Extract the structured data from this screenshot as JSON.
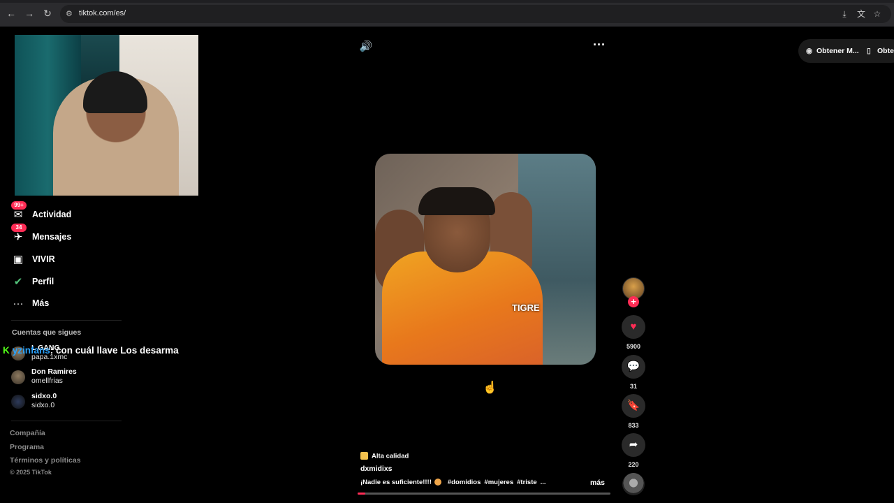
{
  "browser": {
    "url": "tiktok.com/es/",
    "back_icon": "←",
    "forward_icon": "→",
    "reload_icon": "↻",
    "site_icon": "⚙",
    "install_icon": "⤓",
    "translate_icon": "文",
    "bookmark_icon": "☆"
  },
  "sidebar": {
    "items": [
      {
        "label": "Actividad",
        "badge": "99+",
        "icon": "✉"
      },
      {
        "label": "Mensajes",
        "badge": "34",
        "icon": "✈"
      },
      {
        "label": "VIVIR",
        "badge": "",
        "icon": "▣"
      },
      {
        "label": "Perfil",
        "badge": "",
        "icon": "✔"
      },
      {
        "label": "Más",
        "badge": "",
        "icon": "···"
      }
    ],
    "following_title": "Cuentas que sigues",
    "following": [
      {
        "name": "L GANG",
        "user": "papa.1xmc"
      },
      {
        "name": "Don Ramires",
        "user": "omellfrias"
      },
      {
        "name": "sidxo.0",
        "user": "sidxo.0"
      }
    ],
    "footer": [
      "Compañía",
      "Programa",
      "Términos y políticas"
    ],
    "copyright": "© 2025 TikTok"
  },
  "chat": {
    "platform_icon": "K",
    "user": "yzinfans",
    "message": ": con cuál llave Los desarma"
  },
  "player": {
    "volume_icon": "🔊",
    "more_icon": "···",
    "get_app": [
      {
        "icon": "◉",
        "label": "Obtener M..."
      },
      {
        "icon": "▯",
        "label": "Obten"
      }
    ],
    "video_tag": "TIGRE",
    "quality_label": "Alta calidad",
    "author": "dxmidixs",
    "caption_text": "¡Nadie es suficiente!!!!",
    "hashtags": [
      "#domidios",
      "#mujeres",
      "#triste",
      "..."
    ],
    "more_label": "más",
    "progress": 0.03
  },
  "actions": {
    "follow_icon": "+",
    "like": {
      "icon": "♥",
      "count": "5900",
      "color": "#fe2c55"
    },
    "comment": {
      "icon": "💬",
      "count": "31"
    },
    "save": {
      "icon": "🔖",
      "count": "833"
    },
    "share": {
      "icon": "➦",
      "count": "220"
    }
  }
}
